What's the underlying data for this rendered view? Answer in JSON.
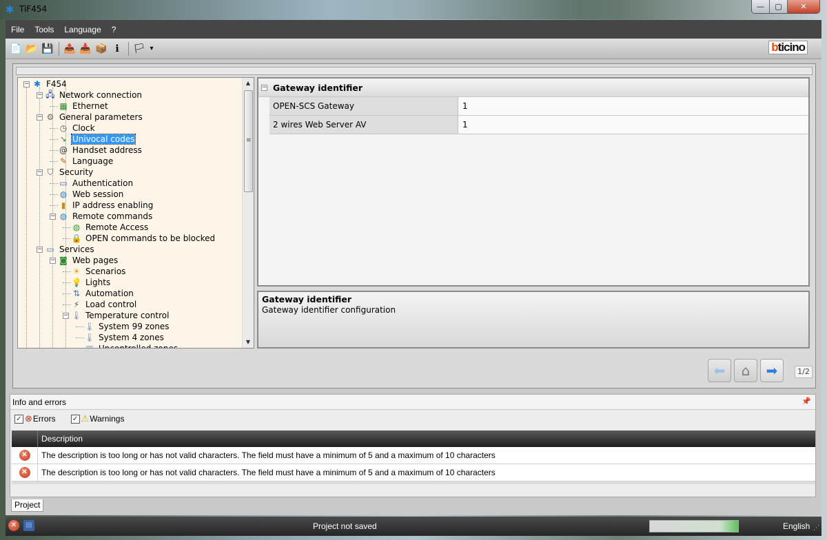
{
  "window": {
    "title": "TiF454",
    "icon": "app-star-icon",
    "controls": {
      "minimize": "—",
      "maximize": "▢",
      "close": "✕"
    }
  },
  "menu": [
    "File",
    "Tools",
    "Language",
    "?"
  ],
  "toolbar": {
    "buttons": [
      {
        "name": "new-icon",
        "glyph": "📄"
      },
      {
        "name": "open-folder-icon",
        "glyph": "📂"
      },
      {
        "name": "save-icon",
        "glyph": "💾"
      },
      {
        "name": "send-icon",
        "glyph": "📤"
      },
      {
        "name": "receive-icon",
        "glyph": "📥"
      },
      {
        "name": "firmware-icon",
        "glyph": "📦"
      },
      {
        "name": "device-info-icon",
        "glyph": "ℹ"
      },
      {
        "name": "language-flags-icon",
        "glyph": "🏳"
      }
    ],
    "dropdown_glyph": "▾",
    "logo_b": "b",
    "logo_rest": "ticino"
  },
  "tree": {
    "nodes": [
      {
        "label": "F454",
        "level": 0,
        "icon": "device-icon",
        "glyph": "✱",
        "color": "#1e7ad6",
        "expander": "−"
      },
      {
        "label": "Network connection",
        "level": 1,
        "icon": "network-icon",
        "glyph": "🖧",
        "color": "#2244aa",
        "expander": "−"
      },
      {
        "label": "Ethernet",
        "level": 2,
        "icon": "ethernet-card-icon",
        "glyph": "▦",
        "color": "#2c8a2c"
      },
      {
        "label": "General parameters",
        "level": 1,
        "icon": "gears-icon",
        "glyph": "⚙",
        "color": "#666",
        "expander": "−"
      },
      {
        "label": "Clock",
        "level": 2,
        "icon": "clock-icon",
        "glyph": "◷",
        "color": "#555"
      },
      {
        "label": "Univocal codes",
        "level": 2,
        "icon": "univocal-codes-icon",
        "glyph": "➘",
        "color": "#3a9a3a",
        "selected": true
      },
      {
        "label": "Handset address",
        "level": 2,
        "icon": "at-sign-icon",
        "glyph": "@",
        "color": "#333"
      },
      {
        "label": "Language",
        "level": 2,
        "icon": "language-flags-icon",
        "glyph": "✎",
        "color": "#c06020"
      },
      {
        "label": "Security",
        "level": 1,
        "icon": "shield-icon",
        "glyph": "⛉",
        "color": "#555",
        "expander": "−"
      },
      {
        "label": "Authentication",
        "level": 2,
        "icon": "keycard-icon",
        "glyph": "▭",
        "color": "#4466aa"
      },
      {
        "label": "Web session",
        "level": 2,
        "icon": "globe-clock-icon",
        "glyph": "◍",
        "color": "#2d7fbf"
      },
      {
        "label": "IP address enabling",
        "level": 2,
        "icon": "traffic-light-icon",
        "glyph": "▮",
        "color": "#c09020"
      },
      {
        "label": "Remote commands",
        "level": 2,
        "icon": "globe-icon",
        "glyph": "◍",
        "color": "#2d7fbf",
        "expander": "−"
      },
      {
        "label": "Remote Access",
        "level": 3,
        "icon": "globe-pencil-icon",
        "glyph": "◍",
        "color": "#3a9a3a"
      },
      {
        "label": "OPEN commands to be blocked",
        "level": 3,
        "icon": "lock-pencil-icon",
        "glyph": "🔒",
        "color": "#c0a030"
      },
      {
        "label": "Services",
        "level": 1,
        "icon": "monitor-icon",
        "glyph": "▭",
        "color": "#5577aa",
        "expander": "−"
      },
      {
        "label": "Web pages",
        "level": 2,
        "icon": "web-page-icon",
        "glyph": "◙",
        "color": "#2c8a2c",
        "expander": "−"
      },
      {
        "label": "Scenarios",
        "level": 3,
        "icon": "scenarios-icon",
        "glyph": "☀",
        "color": "#e0a020"
      },
      {
        "label": "Lights",
        "level": 3,
        "icon": "bulb-icon",
        "glyph": "💡",
        "color": "#e0b040"
      },
      {
        "label": "Automation",
        "level": 3,
        "icon": "automation-icon",
        "glyph": "⇅",
        "color": "#4477aa"
      },
      {
        "label": "Load control",
        "level": 3,
        "icon": "plug-icon",
        "glyph": "⚡",
        "color": "#555"
      },
      {
        "label": "Temperature control",
        "level": 3,
        "icon": "thermometer-icon",
        "glyph": "🌡",
        "color": "#8899bb",
        "expander": "−"
      },
      {
        "label": "System 99 zones",
        "level": 4,
        "icon": "thermometer-99-icon",
        "glyph": "🌡",
        "color": "#8899bb"
      },
      {
        "label": "System 4 zones",
        "level": 4,
        "icon": "thermometer-4-icon",
        "glyph": "🌡",
        "color": "#8899bb"
      },
      {
        "label": "Uncontrolled zones",
        "level": 4,
        "icon": "uncontrolled-zones-icon",
        "glyph": "▥",
        "color": "#8899bb"
      }
    ],
    "scroll": {
      "up": "▲",
      "down": "▼",
      "grip": "≡"
    }
  },
  "properties": {
    "group_title": "Gateway identifier",
    "collapse_glyph": "−",
    "rows": [
      {
        "name": "OPEN-SCS Gateway",
        "value": "1"
      },
      {
        "name": "2 wires Web Server AV",
        "value": "1"
      }
    ]
  },
  "description": {
    "title": "Gateway identifier",
    "text": "Gateway identifier configuration"
  },
  "navigation": {
    "back_glyph": "⬅",
    "home_glyph": "⌂",
    "forward_glyph": "➡",
    "page": "1/2"
  },
  "info_panel": {
    "title": "Info and errors",
    "pin_glyph": "📌",
    "filters": [
      {
        "label": "Errors",
        "checked": true,
        "icon": "error-icon",
        "glyph": "⊗"
      },
      {
        "label": "Warnings",
        "checked": true,
        "icon": "warning-icon",
        "glyph": "⚠"
      }
    ],
    "check_glyph": "✓",
    "columns": [
      "",
      "Description"
    ],
    "rows": [
      {
        "type": "error",
        "glyph": "✕",
        "description": "The description is too long or has not valid characters. The field must have a minimum of 5 and a maximum of 10 characters"
      },
      {
        "type": "error",
        "glyph": "✕",
        "description": "The description is too long or has not valid characters. The field must have a minimum of 5 and a maximum of 10 characters"
      }
    ]
  },
  "tabs": [
    "Project"
  ],
  "status_bar": {
    "error_glyph": "✕",
    "project_glyph": "▤",
    "text": "Project not saved",
    "progress_percent": 100,
    "language": "English",
    "grip": "⋰"
  }
}
